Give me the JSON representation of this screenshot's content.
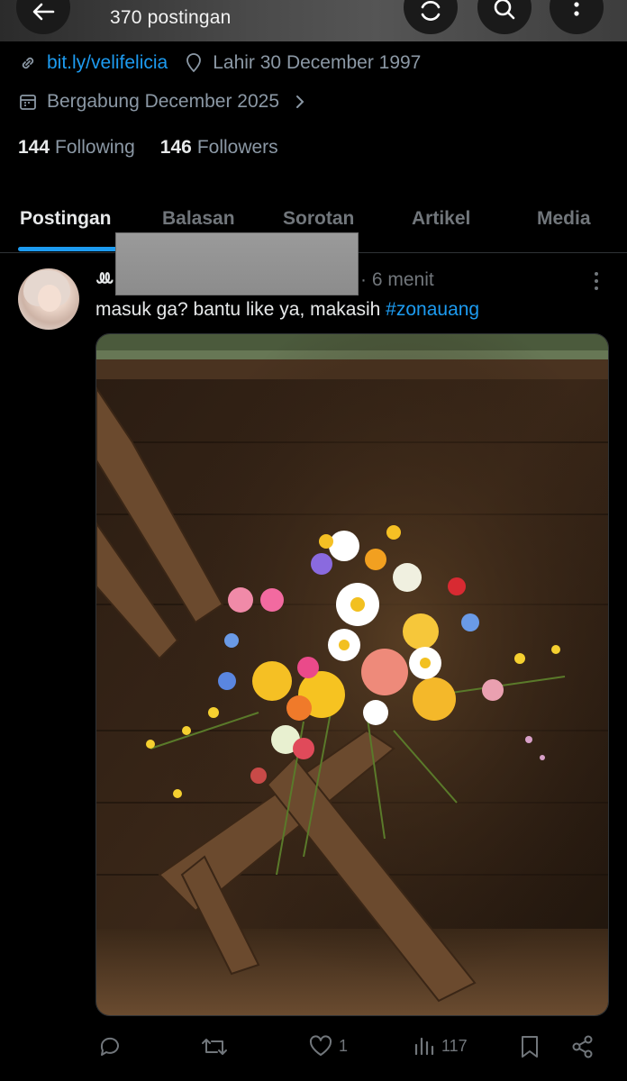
{
  "header": {
    "post_count": "370 postingan",
    "back_icon": "arrow-left-icon",
    "icons": [
      "refresh-icon",
      "search-icon",
      "more-vertical-icon"
    ]
  },
  "profile": {
    "link": "bit.ly/velifelicia",
    "birth": "Lahir 30 December 1997",
    "joined": "Bergabung December 2025",
    "following_count": "144",
    "following_label": "Following",
    "followers_count": "146",
    "followers_label": "Followers"
  },
  "tabs": [
    "Postingan",
    "Balasan",
    "Sorotan",
    "Artikel",
    "Media"
  ],
  "active_tab": "Postingan",
  "tweet": {
    "name_fragment": "ꔛ",
    "time": "· 6 menit",
    "text": "masuk ga? bantu like ya, makasih ",
    "hashtag": "#zonauang",
    "actions": {
      "reply_count": "",
      "retweet_count": "",
      "like_count": "1",
      "views_count": "117"
    }
  },
  "colors": {
    "background": "#000000",
    "accent": "#1d9bf0",
    "muted_text": "#71767b",
    "primary_text": "#e7e9ea"
  }
}
